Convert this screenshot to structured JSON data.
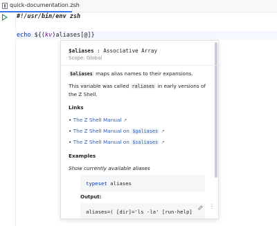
{
  "editor": {
    "tab_label": "quick-documentation.zsh",
    "lines": {
      "shebang": "#!/usr/bin/env zsh",
      "echo_kw": "echo",
      "expr_open": " ${(",
      "expr_flag": "kv",
      "expr_close": ")aliases[@]}"
    }
  },
  "doc": {
    "signature_name": "$aliases",
    "signature_sep": " : ",
    "signature_type": "Associative Array",
    "scope": "Scope: Global",
    "desc1_code": "$aliases",
    "desc1_text": " maps alias names to their expansions.",
    "desc2_pre": "This variable was called ",
    "desc2_code": "raliases",
    "desc2_post": " in early versions of the Z Shell.",
    "links_heading": "Links",
    "links": [
      {
        "text": "The Z Shell Manual",
        "code": ""
      },
      {
        "text": "The Z Shell Manual on ",
        "code": "$galiases"
      },
      {
        "text": "The Z Shell Manual on ",
        "code": "$saliases"
      }
    ],
    "examples_heading": "Examples",
    "examples_desc": "Show currently available aliases",
    "example_kw": "typeset",
    "example_arg": " aliases",
    "output_heading": "Output:",
    "output_line": "aliases=( [dir]='ls -la' [run-help]"
  }
}
